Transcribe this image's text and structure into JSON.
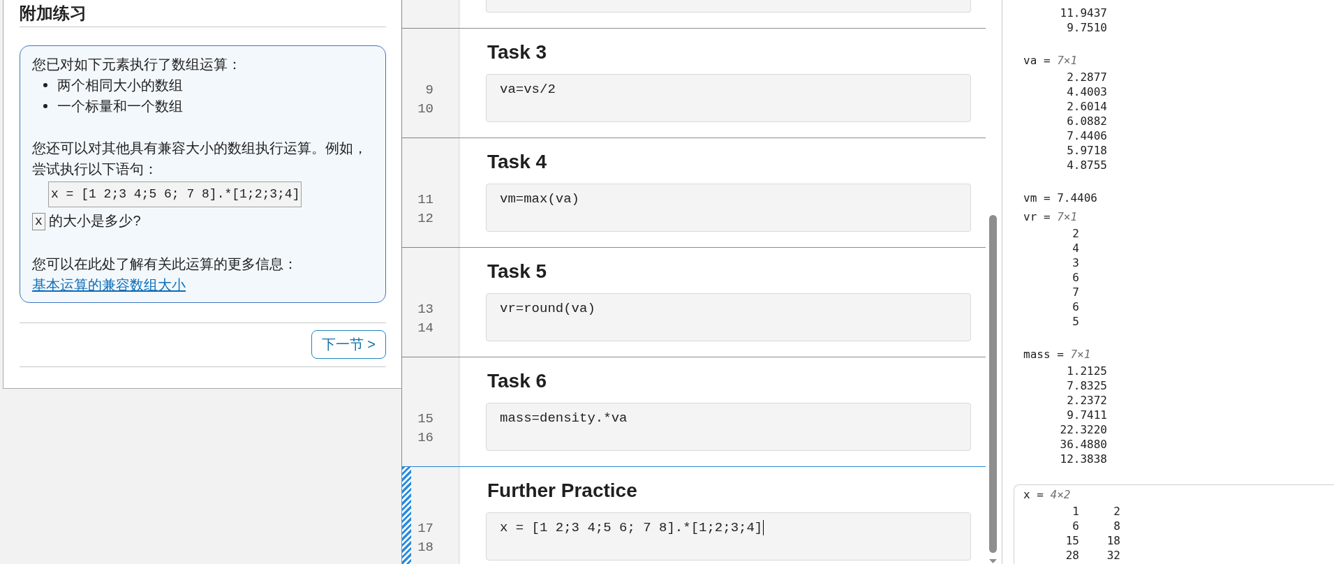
{
  "lesson_panel": {
    "title": "附加练习",
    "callout": {
      "intro": "您已对如下元素执行了数组运算：",
      "bullets": [
        "两个相同大小的数组",
        "一个标量和一个数组"
      ],
      "paragraph": "您还可以对其他具有兼容大小的数组执行运算。例如，尝试执行以下语句：",
      "code": "x = [1 2;3 4;5 6; 7 8].*[1;2;3;4]",
      "question": {
        "code": "x",
        "text": "的大小是多少?"
      },
      "more_info": "您可以在此处了解有关此运算的更多信息：",
      "link": "基本运算的兼容数组大小"
    },
    "next_button": "下一节 >"
  },
  "editor": {
    "sections": [
      {
        "kind": "clipped",
        "selected": false
      },
      {
        "kind": "task",
        "heading": "Task 3",
        "line_numbers": [
          "9",
          "10"
        ],
        "code": "va=vs/2",
        "selected": false
      },
      {
        "kind": "task",
        "heading": "Task 4",
        "line_numbers": [
          "11",
          "12"
        ],
        "code": "vm=max(va)",
        "selected": false
      },
      {
        "kind": "task",
        "heading": "Task 5",
        "line_numbers": [
          "13",
          "14"
        ],
        "code": "vr=round(va)",
        "selected": false
      },
      {
        "kind": "task",
        "heading": "Task 6",
        "line_numbers": [
          "15",
          "16"
        ],
        "code": "mass=density.*va",
        "selected": false
      },
      {
        "kind": "task",
        "heading": "Further Practice",
        "line_numbers": [
          "17",
          "18"
        ],
        "code": "x = [1 2;3 4;5 6; 7 8].*[1;2;3;4]",
        "selected": true
      }
    ]
  },
  "output": {
    "items": [
      {
        "kind": "matrix",
        "rows": [
          [
            "11.9437"
          ],
          [
            "9.7510"
          ]
        ]
      },
      {
        "kind": "matrix",
        "label": "va =",
        "dims": "7×1",
        "rows": [
          [
            "2.2877"
          ],
          [
            "4.4003"
          ],
          [
            "2.6014"
          ],
          [
            "6.0882"
          ],
          [
            "7.4406"
          ],
          [
            "5.9718"
          ],
          [
            "4.8755"
          ]
        ]
      },
      {
        "kind": "scalar",
        "text": "vm = 7.4406"
      },
      {
        "kind": "matrix",
        "label": "vr =",
        "dims": "7×1",
        "rows": [
          [
            "2"
          ],
          [
            "4"
          ],
          [
            "3"
          ],
          [
            "6"
          ],
          [
            "7"
          ],
          [
            "6"
          ],
          [
            "5"
          ]
        ]
      },
      {
        "kind": "matrix",
        "label": "mass =",
        "dims": "7×1",
        "rows": [
          [
            "1.2125"
          ],
          [
            "7.8325"
          ],
          [
            "2.2372"
          ],
          [
            "9.7411"
          ],
          [
            "22.3220"
          ],
          [
            "36.4880"
          ],
          [
            "12.3838"
          ]
        ]
      }
    ],
    "current": {
      "label": "x =",
      "dims": "4×2",
      "rows": [
        [
          "1",
          "2"
        ],
        [
          "6",
          "8"
        ],
        [
          "15",
          "18"
        ],
        [
          "28",
          "32"
        ]
      ]
    }
  }
}
